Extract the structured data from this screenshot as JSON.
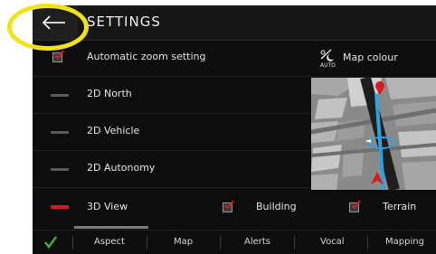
{
  "header": {
    "title": "SETTINGS",
    "back_icon": "back-arrow-icon"
  },
  "settings": {
    "auto_zoom_label": "Automatic zoom setting",
    "auto_zoom_checked": true,
    "views": [
      {
        "label": "2D North",
        "selected": false
      },
      {
        "label": "2D Vehicle",
        "selected": false
      },
      {
        "label": "2D Autonomy",
        "selected": false
      },
      {
        "label": "3D View",
        "selected": true
      }
    ],
    "map_colour_label": "Map colour",
    "map_colour_icon": "day-night-auto-icon",
    "map_colour_icon_text": "AUTO",
    "building_label": "Building",
    "building_checked": true,
    "terrain_label": "Terrain",
    "terrain_checked": true
  },
  "tabs": [
    {
      "label": "Aspect",
      "active": true
    },
    {
      "label": "Map",
      "active": false
    },
    {
      "label": "Alerts",
      "active": false
    },
    {
      "label": "Vocal",
      "active": false
    },
    {
      "label": "Mapping",
      "active": false
    }
  ],
  "colors": {
    "accent_red": "#d8191f",
    "confirm_green": "#3fbf3f",
    "highlight_yellow": "#f2e21a",
    "route_blue": "#2aa3e0"
  }
}
